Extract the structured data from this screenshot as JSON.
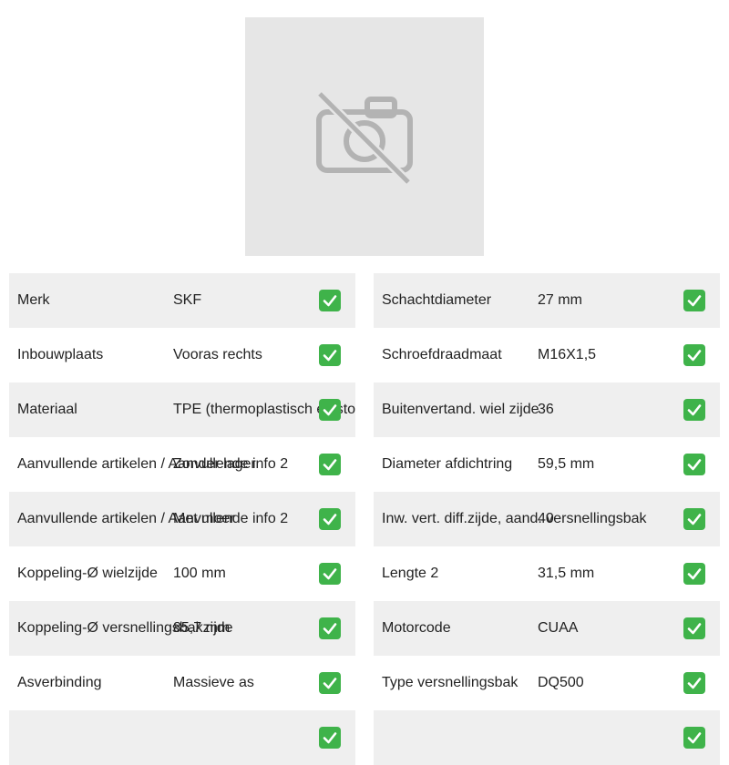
{
  "image": {
    "icon": "no-photo-icon"
  },
  "accent_color": "#3fb34a",
  "left_specs": [
    {
      "label": "Merk",
      "value": "SKF"
    },
    {
      "label": "Inbouwplaats",
      "value": "Vooras rechts"
    },
    {
      "label": "Materiaal",
      "value": "TPE (thermoplastisch elastomeer)"
    },
    {
      "label": "Aanvullende artikelen / Aanvullende info 2",
      "value": "Zonder lager"
    },
    {
      "label": "Aanvullende artikelen / Aanvullende info 2",
      "value": "Met moer"
    },
    {
      "label": "Koppeling-Ø wielzijde",
      "value": "100 mm"
    },
    {
      "label": "Koppeling-Ø versnellingsbakzijde",
      "value": "85,7 mm"
    },
    {
      "label": "Asverbinding",
      "value": "Massieve as"
    }
  ],
  "right_specs": [
    {
      "label": "Schachtdiameter",
      "value": "27 mm"
    },
    {
      "label": "Schroefdraadmaat",
      "value": "M16X1,5"
    },
    {
      "label": "Buitenvertand. wiel zijde",
      "value": "36"
    },
    {
      "label": "Diameter afdichtring",
      "value": "59,5 mm"
    },
    {
      "label": "Inw. vert. diff.zijde, aand. versnellingsbak",
      "value": "40"
    },
    {
      "label": "Lengte 2",
      "value": "31,5 mm"
    },
    {
      "label": "Motorcode",
      "value": "CUAA"
    },
    {
      "label": "Type versnellingsbak",
      "value": "DQ500"
    }
  ]
}
